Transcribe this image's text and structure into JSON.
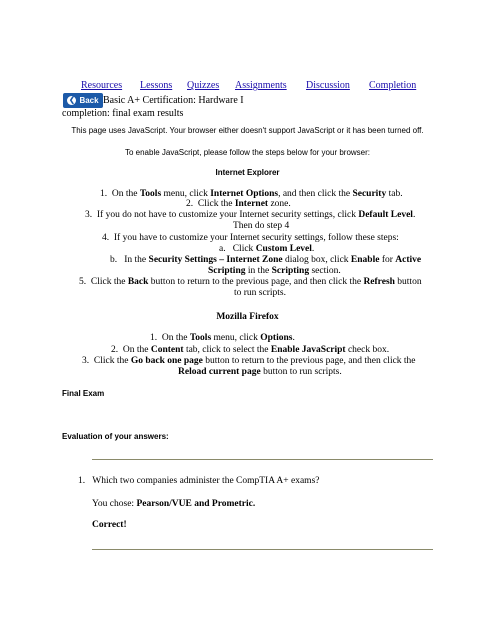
{
  "nav": [
    "Resources",
    "Lessons",
    "Quizzes",
    "Assignments",
    "Discussion",
    "Completion"
  ],
  "back_label": "Back",
  "course_title": "Basic A+ Certification: Hardware I",
  "completion_title": "completion: final exam results",
  "js_notice": "This page uses JavaScript. Your browser either doesn't support JavaScript or it has been turned off.",
  "js_enable": "To enable JavaScript, please follow the steps below for your browser:",
  "ie": {
    "heading": "Internet Explorer",
    "step1": {
      "n": "1.",
      "a": "On the ",
      "b": "Tools",
      "c": " menu, click ",
      "d": "Internet Options",
      "e": ", and then click the ",
      "f": "Security",
      "g": " tab."
    },
    "step2": {
      "n": "2.",
      "a": "Click the ",
      "b": "Internet",
      "c": " zone."
    },
    "step3": {
      "n": "3.",
      "a": "If you do not have to customize your Internet security settings, click ",
      "b": "Default Level",
      "c": ".",
      "cont": "Then do step 4"
    },
    "step4": {
      "n": "4.",
      "a": "If you have to customize your Internet security settings, follow these steps:"
    },
    "step4a": {
      "n": "a.",
      "a": "Click ",
      "b": "Custom Level",
      "c": "."
    },
    "step4b": {
      "n": "b.",
      "a": "In the ",
      "b": "Security Settings – Internet Zone",
      "c": " dialog box, click ",
      "d": "Enable",
      "e": " for ",
      "f": "Active",
      "cont1": "Scripting",
      "cont2": " in the ",
      "cont3": "Scripting",
      "cont4": " section."
    },
    "step5": {
      "n": "5.",
      "a": "Click the ",
      "b": "Back",
      "c": " button to return to the previous page, and then click the ",
      "d": "Refresh",
      "e": " button",
      "cont": "to run scripts."
    }
  },
  "ff": {
    "heading": "Mozilla Firefox",
    "step1": {
      "n": "1.",
      "a": "On the ",
      "b": "Tools",
      "c": " menu, click ",
      "d": "Options",
      "e": "."
    },
    "step2": {
      "n": "2.",
      "a": "On the ",
      "b": "Content",
      "c": " tab, click to select the ",
      "d": "Enable JavaScript",
      "e": " check box."
    },
    "step3": {
      "n": "3.",
      "a": "Click the ",
      "b": "Go back one page",
      "c": " button to return to the previous page, and then click the",
      "cont1": "Reload current page",
      "cont2": " button to run scripts."
    }
  },
  "final_exam": "Final Exam",
  "evaluation": "Evaluation of your answers:",
  "question": {
    "number": "1.",
    "text": "Which two companies administer the CompTIA A+ exams?",
    "chose_label": "You chose: ",
    "chose_value": "Pearson/VUE and Prometric.",
    "result": "Correct!"
  }
}
